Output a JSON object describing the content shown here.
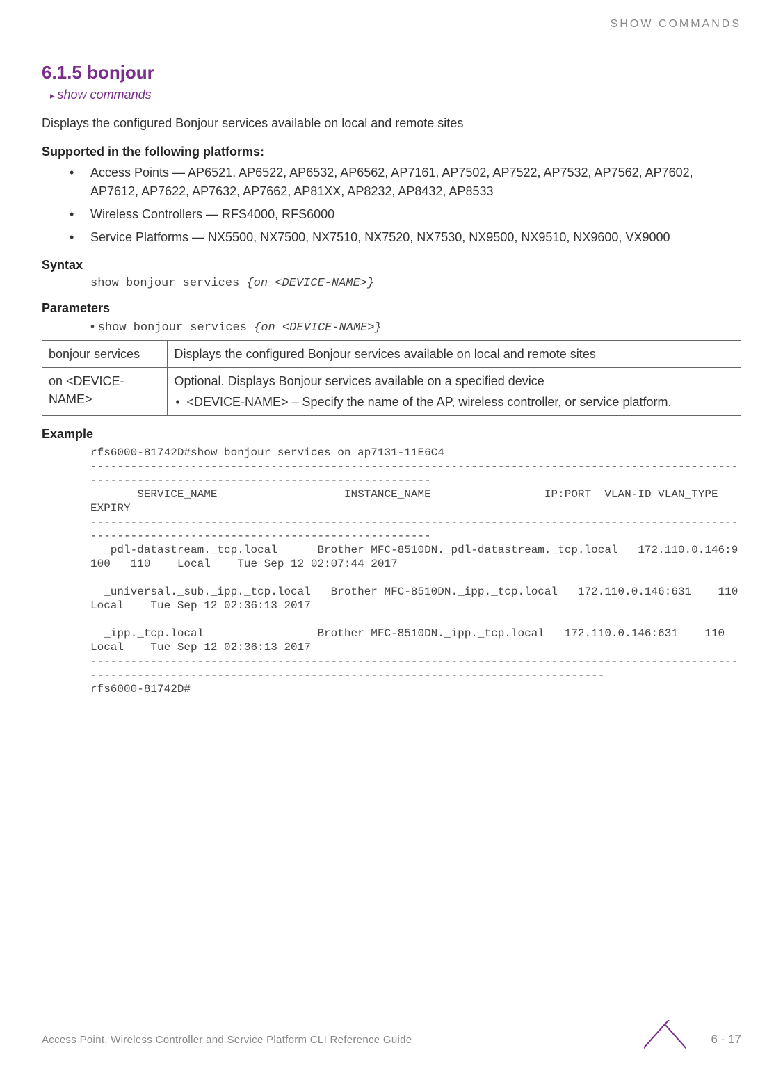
{
  "header": {
    "right": "SHOW COMMANDS"
  },
  "section": {
    "number_title": "6.1.5 bonjour",
    "breadcrumb": "show commands",
    "description": "Displays the configured Bonjour services available on local and remote sites"
  },
  "supported": {
    "heading": "Supported in the following platforms:",
    "items": [
      "Access Points — AP6521, AP6522, AP6532, AP6562, AP7161, AP7502, AP7522, AP7532, AP7562, AP7602, AP7612, AP7622, AP7632, AP7662, AP81XX, AP8232, AP8432, AP8533",
      "Wireless Controllers — RFS4000, RFS6000",
      "Service Platforms — NX5500, NX7500, NX7510, NX7520, NX7530, NX9500, NX9510, NX9600, VX9000"
    ]
  },
  "syntax": {
    "heading": "Syntax",
    "line_plain": "show bonjour services ",
    "line_italic": "{on <DEVICE-NAME>}"
  },
  "parameters": {
    "heading": "Parameters",
    "line_bullet": "• ",
    "line_plain": "show bonjour services ",
    "line_italic": "{on <DEVICE-NAME>}",
    "table": [
      {
        "name": "bonjour services",
        "desc": "Displays the configured Bonjour services available on local and remote sites"
      },
      {
        "name": "on <DEVICE-NAME>",
        "desc": "Optional. Displays Bonjour services available on a specified device",
        "sub": "<DEVICE-NAME> – Specify the name of the AP, wireless controller, or service platform."
      }
    ]
  },
  "example": {
    "heading": "Example",
    "text": "rfs6000-81742D#show bonjour services on ap7131-11E6C4\n----------------------------------------------------------------------------------------------------------------------------------------------------\n       SERVICE_NAME                   INSTANCE_NAME                 IP:PORT  VLAN-ID VLAN_TYPE            EXPIRY\n----------------------------------------------------------------------------------------------------------------------------------------------------\n  _pdl-datastream._tcp.local      Brother MFC-8510DN._pdl-datastream._tcp.local   172.110.0.146:9100   110    Local    Tue Sep 12 02:07:44 2017\n\n  _universal._sub._ipp._tcp.local   Brother MFC-8510DN._ipp._tcp.local   172.110.0.146:631    110    Local    Tue Sep 12 02:36:13 2017\n\n  _ipp._tcp.local                 Brother MFC-8510DN._ipp._tcp.local   172.110.0.146:631    110    Local    Tue Sep 12 02:36:13 2017\n------------------------------------------------------------------------------------------------------------------------------------------------------------------------------\nrfs6000-81742D#"
  },
  "footer": {
    "text": "Access Point, Wireless Controller and Service Platform CLI Reference Guide",
    "page": "6 - 17"
  }
}
